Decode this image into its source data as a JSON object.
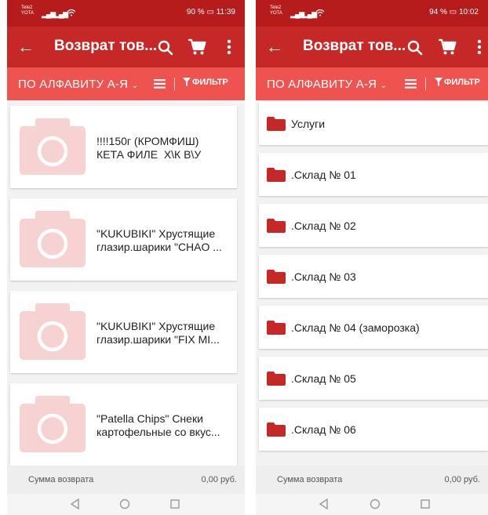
{
  "colors": {
    "status_bar": "#b71c1c",
    "toolbar": "#c62828",
    "sort_bar": "#ef5350",
    "folder_icon": "#c62828",
    "placeholder_image": "#f7d2d2"
  },
  "left_screen": {
    "status": {
      "carrier": "Tele2 YOTA",
      "battery": "90 %",
      "time": "11:39"
    },
    "toolbar": {
      "back_icon": "arrow-left-icon",
      "title": "Возврат тов...",
      "actions": [
        "search-icon",
        "cart-icon",
        "more-icon"
      ]
    },
    "sort_bar": {
      "sort_label": "ПО АЛФАВИТУ А-Я",
      "view_icon": "list-icon",
      "filter_label": "ФИЛЬТР"
    },
    "products": [
      {
        "name": "!!!!150г (КРОМФИШ)\nКЕТА ФИЛЕ  Х\\К В\\У",
        "image": "camera-placeholder-icon"
      },
      {
        "name": "\"KUKUBIKI\" Хрустящие\nглазир.шарики \"CHAO ...",
        "image": "camera-placeholder-icon"
      },
      {
        "name": "\"KUKUBIKI\" Хрустящие\nглазир.шарики \"FIX MI...",
        "image": "camera-placeholder-icon"
      },
      {
        "name": "\"Patella Chips\" Снеки\nкартофельные со вкус...",
        "image": "camera-placeholder-icon"
      }
    ],
    "footer": {
      "sum_label": "Сумма возврата",
      "sum_value": "0,00 руб."
    }
  },
  "right_screen": {
    "status": {
      "carrier": "Tele2 YOTA",
      "battery": "94 %",
      "time": "10:02"
    },
    "toolbar": {
      "back_icon": "arrow-left-icon",
      "title": "Возврат тов...",
      "actions": [
        "search-icon",
        "cart-icon",
        "more-icon"
      ]
    },
    "sort_bar": {
      "sort_label": "ПО АЛФАВИТУ А-Я",
      "view_icon": "list-icon",
      "filter_label": "ФИЛЬТР"
    },
    "folders": [
      {
        "label": "Услуги"
      },
      {
        "label": ".Склад № 01"
      },
      {
        "label": ".Склад № 02"
      },
      {
        "label": ".Склад № 03"
      },
      {
        "label": ".Склад № 04 (заморозка)"
      },
      {
        "label": ".Склад № 05"
      },
      {
        "label": ".Склад № 06"
      }
    ],
    "footer": {
      "sum_label": "Сумма возврата",
      "sum_value": "0,00 руб."
    }
  }
}
